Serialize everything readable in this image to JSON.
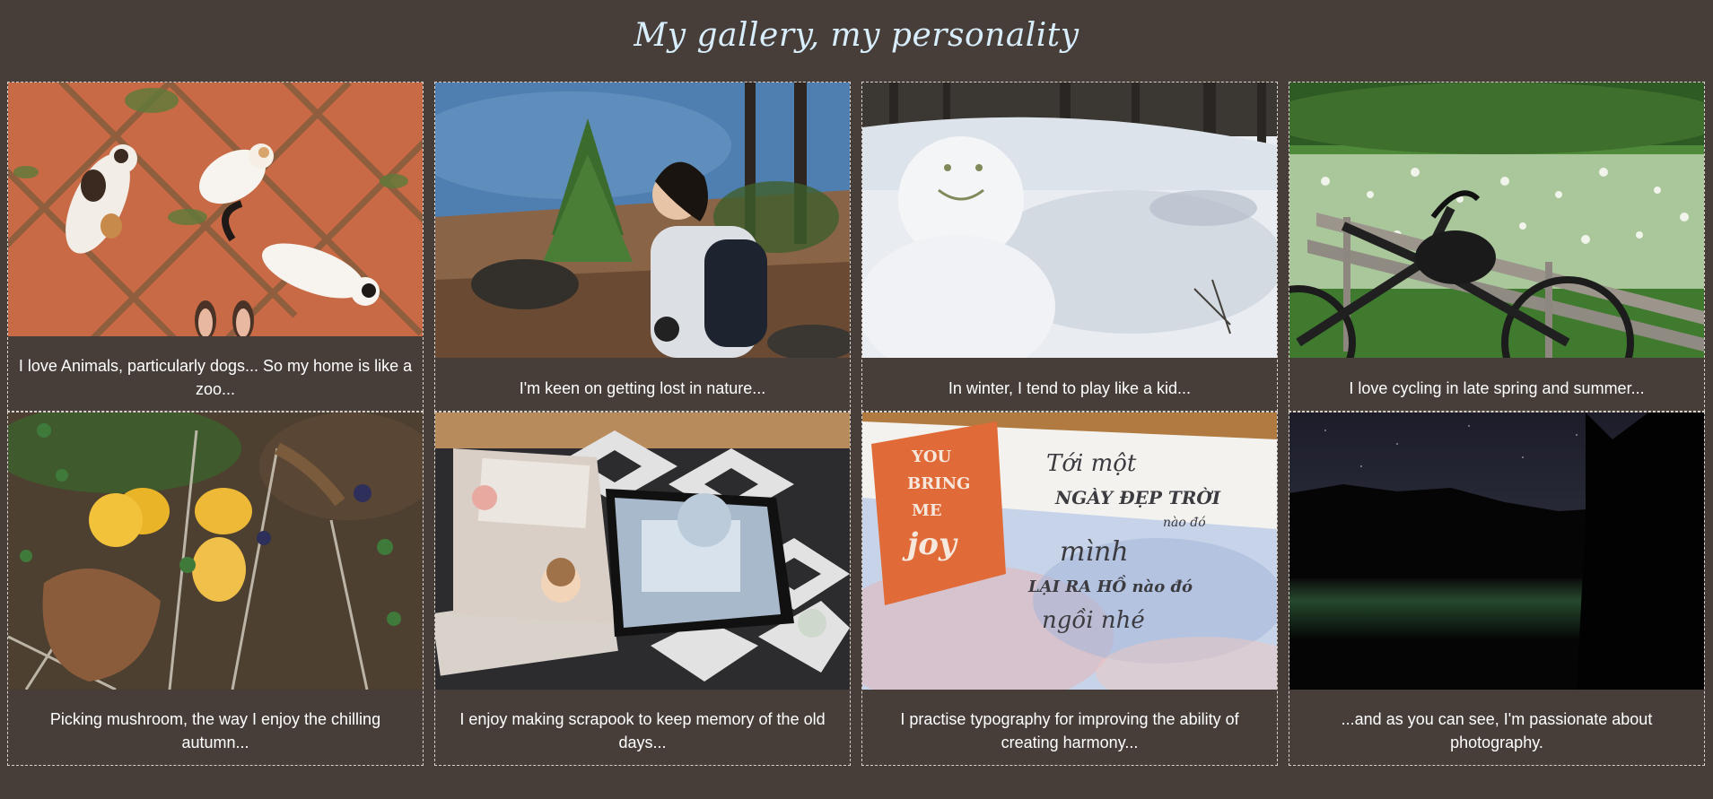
{
  "page": {
    "title": "My gallery, my personality"
  },
  "gallery": {
    "items": [
      {
        "caption": "I love Animals, particularly dogs... So my home is like a zoo...",
        "photo": "cats-on-tile-floor-photo"
      },
      {
        "caption": "I'm keen on getting lost in nature...",
        "photo": "hiker-by-lake-photo"
      },
      {
        "caption": "In winter, I tend to play like a kid...",
        "photo": "snowman-photo"
      },
      {
        "caption": "I love cycling in late spring and summer...",
        "photo": "bicycle-flower-field-photo"
      },
      {
        "caption": "Picking mushroom, the way I enjoy the chilling autumn...",
        "photo": "mushrooms-photo"
      },
      {
        "caption": "I enjoy making scrapook to keep memory of the old days...",
        "photo": "scrapbook-photo"
      },
      {
        "caption": "I practise typography for improving the ability of creating harmony...",
        "photo": "typography-card-photo"
      },
      {
        "caption": "...and as you can see, I'm passionate about photography.",
        "photo": "aurora-night-lake-photo"
      }
    ],
    "artwork": {
      "typography_card": {
        "badge_lines": [
          "YOU",
          "BRING",
          "ME",
          "joy"
        ],
        "handwriting_lines": [
          "Tới một",
          "NGÀY ĐẸP TRỜI",
          "nào đó",
          "mình",
          "LẠI RA HỒ nào đó",
          "ngồi nhé"
        ]
      }
    }
  },
  "colors": {
    "background": "#473e3a",
    "title": "#d8eefc",
    "caption": "#ffffff",
    "card_border": "#d8d2cc"
  }
}
